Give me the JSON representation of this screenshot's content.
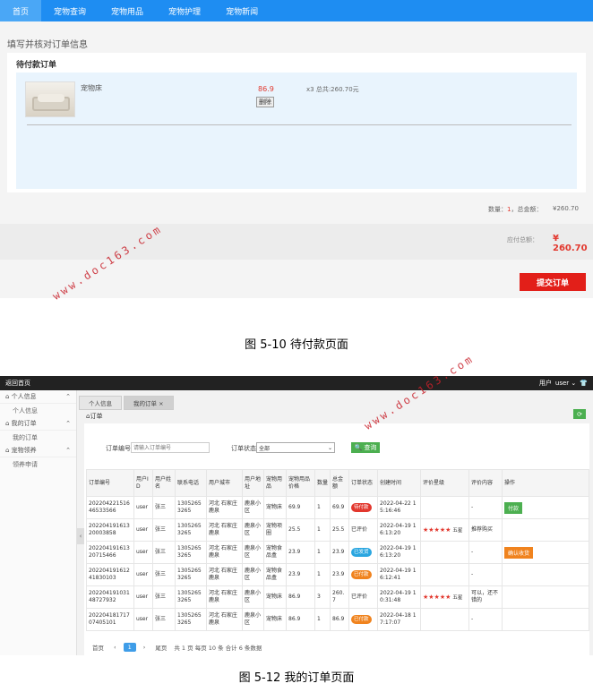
{
  "figure1": {
    "nav": [
      "首页",
      "宠物查询",
      "宠物用品",
      "宠物护理",
      "宠物新闻"
    ],
    "section_title": "填写并核对订单信息",
    "card_title": "待付款订单",
    "product": {
      "name": "宠物床",
      "price": "86.9",
      "delete_label": "删除",
      "qty_total": "x3  总共:260.70元"
    },
    "summary": {
      "qty_label": "数量：",
      "qty_value": "1",
      "total_label": "，总金额：",
      "total_amount": "¥260.70"
    },
    "pay_label": "应付总额：",
    "pay_amount": "¥ 260.70",
    "submit_label": "提交订单"
  },
  "watermark": "www.doc163.com",
  "captions": [
    "图 5-10 待付款页面",
    "图 5-12 我的订单页面"
  ],
  "figure2": {
    "topbar": {
      "home_link": "返回首页",
      "user_role": "用户",
      "username": "user",
      "shirt_icon": "shirt-icon"
    },
    "sidebar": [
      {
        "group": "个人信息",
        "items": [
          "个人信息"
        ]
      },
      {
        "group": "我的订单",
        "items": [
          "我的订单"
        ]
      },
      {
        "group": "宠物领养",
        "items": [
          "领养申请"
        ]
      }
    ],
    "tabs": [
      "个人信息",
      "我的订单 ×"
    ],
    "crumb": "订单",
    "search": {
      "order_no_label": "订单编号",
      "order_no_placeholder": "请输入订单编号",
      "status_label": "订单状态",
      "status_value": "全部",
      "query_label": "查询"
    },
    "table": {
      "headers": [
        "订单编号",
        "用户ID",
        "用户姓名",
        "联系电话",
        "用户城市",
        "用户地址",
        "宠物用品",
        "宠物用品价格",
        "数量",
        "总金额",
        "订单状态",
        "创建时间",
        "评价星级",
        "评价内容",
        "操作"
      ],
      "rows": [
        {
          "id": "20220422151646533566",
          "uid": "user",
          "name": "张三",
          "phone": "13052653265",
          "city": "河北 石家庄 鹿泉",
          "addr": "鹿泉小区",
          "item": "宠物床",
          "price": "69.9",
          "qty": "1",
          "total": "69.9",
          "status": "待付款",
          "status_color": "#e2372d",
          "time": "2022-04-22 15:16:46",
          "stars": "",
          "rating": "",
          "review": "-",
          "action": "付款",
          "action_color": "#4caf50"
        },
        {
          "id": "20220419161320003858",
          "uid": "user",
          "name": "张三",
          "phone": "13052653265",
          "city": "河北 石家庄 鹿泉",
          "addr": "鹿泉小区",
          "item": "宠物项圈",
          "price": "25.5",
          "qty": "1",
          "total": "25.5",
          "status": "已评价",
          "status_color": "",
          "time": "2022-04-19 16:13:20",
          "stars": "★★★★★",
          "rating": "五星",
          "review": "推荐购买",
          "action": "",
          "action_color": ""
        },
        {
          "id": "20220419161320715466",
          "uid": "user",
          "name": "张三",
          "phone": "13052653265",
          "city": "河北 石家庄 鹿泉",
          "addr": "鹿泉小区",
          "item": "宠物食品盒",
          "price": "23.9",
          "qty": "1",
          "total": "23.9",
          "status": "已发货",
          "status_color": "#2aa6e0",
          "time": "2022-04-19 16:13:20",
          "stars": "",
          "rating": "",
          "review": "-",
          "action": "确认收货",
          "action_color": "#f0831e"
        },
        {
          "id": "20220419161241830103",
          "uid": "user",
          "name": "张三",
          "phone": "13052653265",
          "city": "河北 石家庄 鹿泉",
          "addr": "鹿泉小区",
          "item": "宠物食品盒",
          "price": "23.9",
          "qty": "1",
          "total": "23.9",
          "status": "已付款",
          "status_color": "#f0831e",
          "time": "2022-04-19 16:12:41",
          "stars": "",
          "rating": "",
          "review": "-",
          "action": "",
          "action_color": ""
        },
        {
          "id": "20220419103148727932",
          "uid": "user",
          "name": "张三",
          "phone": "13052653265",
          "city": "河北 石家庄 鹿泉",
          "addr": "鹿泉小区",
          "item": "宠物床",
          "price": "86.9",
          "qty": "3",
          "total": "260.7",
          "status": "已评价",
          "status_color": "",
          "time": "2022-04-19 10:31:48",
          "stars": "★★★★★",
          "rating": "五星",
          "review": "可以，还不错的",
          "action": "",
          "action_color": ""
        },
        {
          "id": "20220418171707405101",
          "uid": "user",
          "name": "张三",
          "phone": "13052653265",
          "city": "河北 石家庄 鹿泉",
          "addr": "鹿泉小区",
          "item": "宠物床",
          "price": "86.9",
          "qty": "1",
          "total": "86.9",
          "status": "已付款",
          "status_color": "#f0831e",
          "time": "2022-04-18 17:17:07",
          "stars": "",
          "rating": "",
          "review": "-",
          "action": "",
          "action_color": ""
        }
      ]
    },
    "pager": {
      "first": "首页",
      "prev": "‹",
      "current": "1",
      "next": "›",
      "last": "尾页",
      "info": "共 1 页  每页 10 条  合计 6 条数据"
    }
  }
}
